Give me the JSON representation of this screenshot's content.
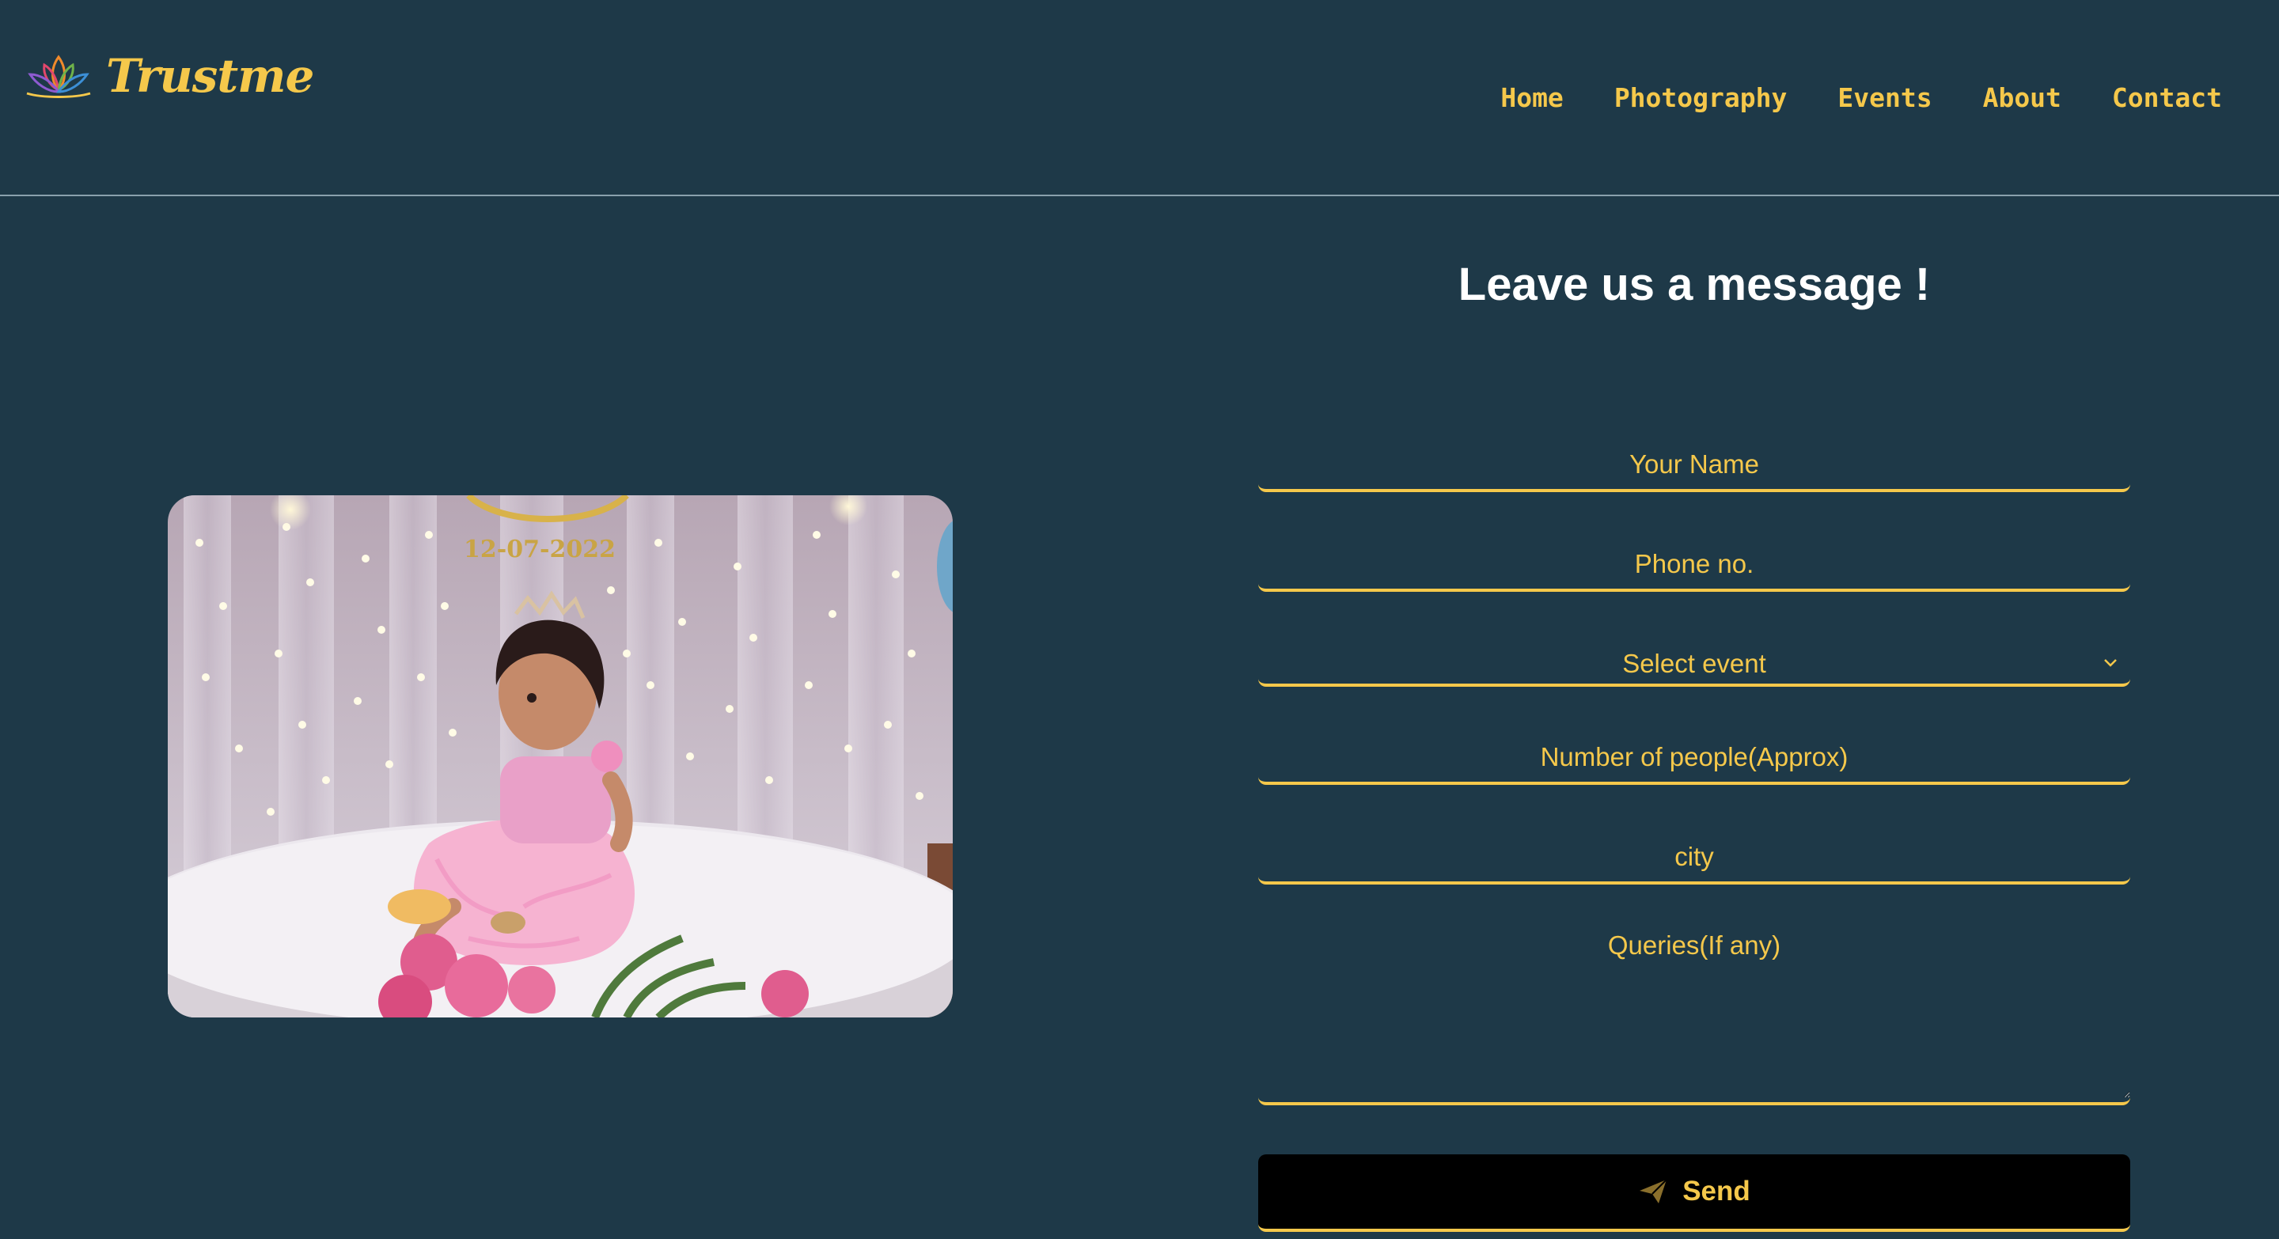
{
  "brand": {
    "name": "Trustme",
    "logo_icon": "lotus-icon",
    "logo_colors": [
      "#e2476c",
      "#f08a2b",
      "#f5c84b",
      "#6fb24a",
      "#3c8fd6",
      "#8e5bd1"
    ]
  },
  "nav": {
    "items": [
      {
        "label": "Home"
      },
      {
        "label": "Photography"
      },
      {
        "label": "Events"
      },
      {
        "label": "About"
      },
      {
        "label": "Contact"
      }
    ]
  },
  "form": {
    "title": "Leave us a message !",
    "name_placeholder": "Your Name",
    "phone_placeholder": "Phone no.",
    "event_select": {
      "selected": "Select event",
      "icon": "chevron-down-icon"
    },
    "people_placeholder": "Number of people(Approx)",
    "city_placeholder": "city",
    "queries_placeholder": "Queries(If any)",
    "send_label": "Send",
    "send_icon": "paper-plane-icon"
  },
  "photo": {
    "banner_text": "12-07-2022"
  },
  "colors": {
    "background": "#1e3948",
    "accent": "#f5c84b",
    "heading": "#ffffff",
    "button": "#000000"
  }
}
